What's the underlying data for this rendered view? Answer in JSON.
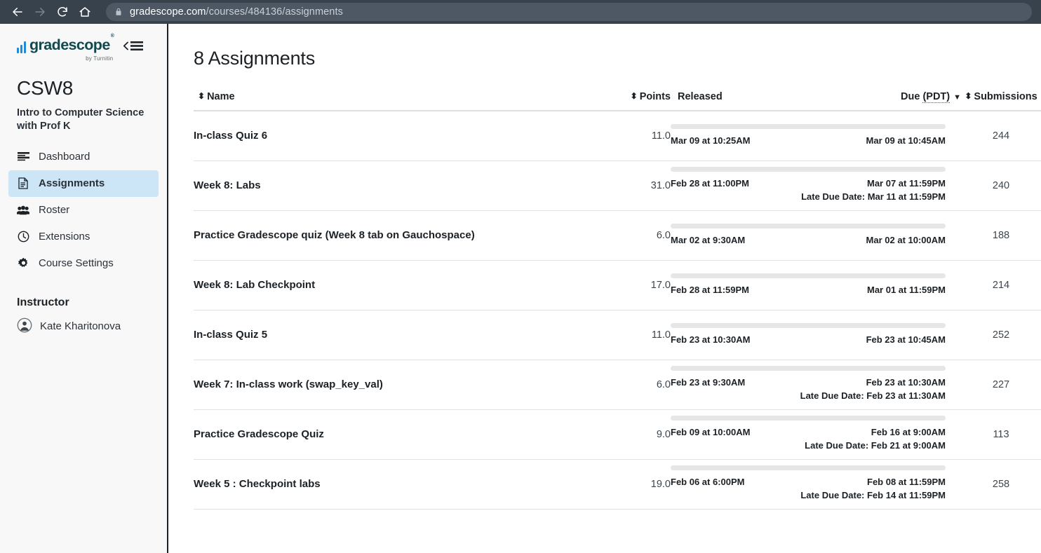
{
  "browser": {
    "back_icon": "arrow-left-icon",
    "forward_icon": "arrow-right-icon",
    "reload_icon": "reload-icon",
    "home_icon": "home-icon",
    "lock_icon": "lock-icon",
    "url_host": "gradescope.com",
    "url_path": "/courses/484136/assignments",
    "url_full": "gradescope.com/courses/484136/assignments"
  },
  "sidebar": {
    "logo": {
      "wordmark": "gradescope",
      "registered": "®",
      "tagline": "by Turnitin",
      "bars_icon": "bar-chart-icon",
      "bar_color": "#1a8cd8",
      "word_color": "#12494f"
    },
    "collapse_label": "‹",
    "course_code": "CSW8",
    "course_title": "Intro to Computer Science with Prof K",
    "nav_items": [
      {
        "label": "Dashboard",
        "icon": "dashboard-icon",
        "active": false
      },
      {
        "label": "Assignments",
        "icon": "document-icon",
        "active": true
      },
      {
        "label": "Roster",
        "icon": "people-icon",
        "active": false
      },
      {
        "label": "Extensions",
        "icon": "clock-icon",
        "active": false
      },
      {
        "label": "Course Settings",
        "icon": "gear-icon",
        "active": false
      }
    ],
    "instructor_heading": "Instructor",
    "instructor_name": "Kate Kharitonova",
    "instructor_avatar_icon": "user-circle-icon",
    "active_highlight_color": "#cce5f7"
  },
  "main": {
    "page_title": "8 Assignments",
    "columns": {
      "name": "Name",
      "points": "Points",
      "released": "Released",
      "due": "Due",
      "due_tz": "(PDT)",
      "submissions": "Submissions",
      "sort_icon": "sort-updown-icon",
      "due_sort_icon": "caret-down-icon"
    },
    "rows": [
      {
        "name": "In-class Quiz 6",
        "points": "11.0",
        "released": "Mar 09 at 10:25AM",
        "due": "Mar 09 at 10:45AM",
        "late_due": "",
        "submissions": "244"
      },
      {
        "name": "Week 8: Labs",
        "points": "31.0",
        "released": "Feb 28 at 11:00PM",
        "due": "Mar 07 at 11:59PM",
        "late_due": "Late Due Date: Mar 11 at 11:59PM",
        "submissions": "240"
      },
      {
        "name": "Practice Gradescope quiz (Week 8 tab on Gauchospace)",
        "points": "6.0",
        "released": "Mar 02 at 9:30AM",
        "due": "Mar 02 at 10:00AM",
        "late_due": "",
        "submissions": "188"
      },
      {
        "name": "Week 8: Lab Checkpoint",
        "points": "17.0",
        "released": "Feb 28 at 11:59PM",
        "due": "Mar 01 at 11:59PM",
        "late_due": "",
        "submissions": "214"
      },
      {
        "name": "In-class Quiz 5",
        "points": "11.0",
        "released": "Feb 23 at 10:30AM",
        "due": "Feb 23 at 10:45AM",
        "late_due": "",
        "submissions": "252"
      },
      {
        "name": "Week 7: In-class work (swap_key_val)",
        "points": "6.0",
        "released": "Feb 23 at 9:30AM",
        "due": "Feb 23 at 10:30AM",
        "late_due": "Late Due Date: Feb 23 at 11:30AM",
        "submissions": "227"
      },
      {
        "name": "Practice Gradescope Quiz",
        "points": "9.0",
        "released": "Feb 09 at 10:00AM",
        "due": "Feb 16 at 9:00AM",
        "late_due": "Late Due Date: Feb 21 at 9:00AM",
        "submissions": "113"
      },
      {
        "name": "Week 5 : Checkpoint labs",
        "points": "19.0",
        "released": "Feb 06 at 6:00PM",
        "due": "Feb 08 at 11:59PM",
        "late_due": "Late Due Date: Feb 14 at 11:59PM",
        "submissions": "258"
      }
    ]
  }
}
